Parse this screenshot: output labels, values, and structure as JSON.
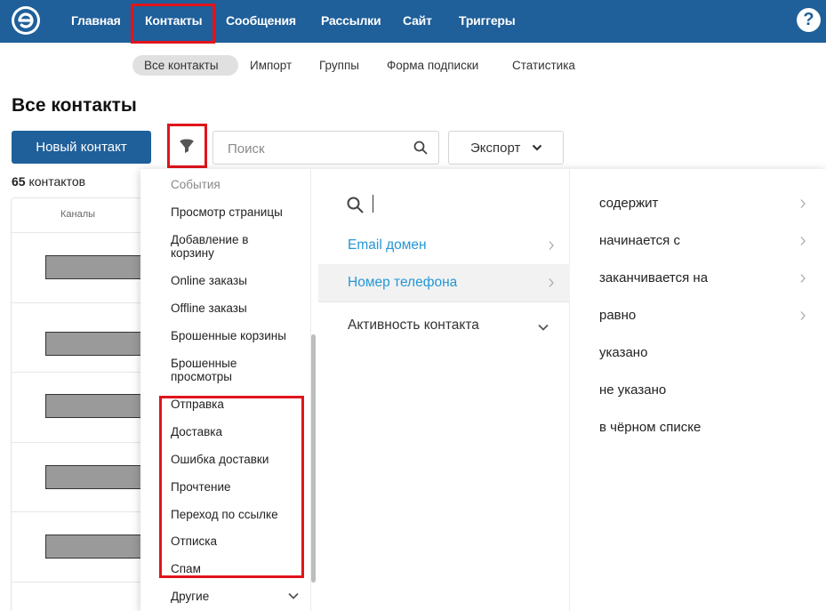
{
  "nav": {
    "items": [
      "Главная",
      "Контакты",
      "Сообщения",
      "Рассылки",
      "Сайт",
      "Триггеры"
    ],
    "help": "?"
  },
  "subnav": {
    "items": [
      "Все контакты",
      "Импорт",
      "Группы",
      "Форма подписки",
      "Статистика"
    ]
  },
  "page": {
    "title": "Все контакты",
    "new_contact": "Новый контакт",
    "search_placeholder": "Поиск",
    "export": "Экспорт",
    "count_number": "65",
    "count_label": " контактов",
    "channels_header": "Каналы"
  },
  "filter_menu": {
    "events_header": "События",
    "events": [
      "Просмотр страницы",
      "Добавление в корзину",
      "Online заказы",
      "Offline заказы",
      "Брошенные корзины",
      "Брошенные просмотры",
      "Отправка",
      "Доставка",
      "Ошибка доставки",
      "Прочтение",
      "Переход по ссылке",
      "Отписка",
      "Спам",
      "Другие"
    ],
    "fields": [
      "Email домен",
      "Номер телефона",
      "Активность контакта"
    ],
    "conditions": [
      "содержит",
      "начинается с",
      "заканчивается на",
      "равно",
      "указано",
      "не указано",
      "в чёрном списке"
    ]
  },
  "colors": {
    "nav_bg": "#1f5f9a",
    "link": "#2597d6",
    "highlight_border": "#e0141b"
  }
}
